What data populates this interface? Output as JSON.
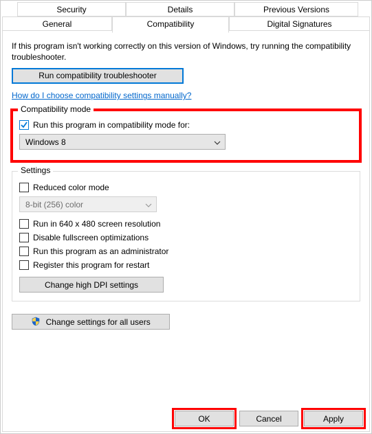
{
  "tabs": {
    "security": "Security",
    "details": "Details",
    "previous": "Previous Versions",
    "general": "General",
    "compatibility": "Compatibility",
    "signatures": "Digital Signatures"
  },
  "intro": "If this program isn't working correctly on this version of Windows, try running the compatibility troubleshooter.",
  "run_troubleshooter": "Run compatibility troubleshooter",
  "manual_link": "How do I choose compatibility settings manually?",
  "compat_mode": {
    "legend": "Compatibility mode",
    "checkbox": "Run this program in compatibility mode for:",
    "selected": "Windows 8"
  },
  "settings": {
    "legend": "Settings",
    "reduced_color": "Reduced color mode",
    "color_value": "8-bit (256) color",
    "res640": "Run in 640 x 480 screen resolution",
    "disable_fs": "Disable fullscreen optimizations",
    "run_admin": "Run this program as an administrator",
    "register_restart": "Register this program for restart",
    "high_dpi": "Change high DPI settings"
  },
  "all_users": "Change settings for all users",
  "buttons": {
    "ok": "OK",
    "cancel": "Cancel",
    "apply": "Apply"
  }
}
